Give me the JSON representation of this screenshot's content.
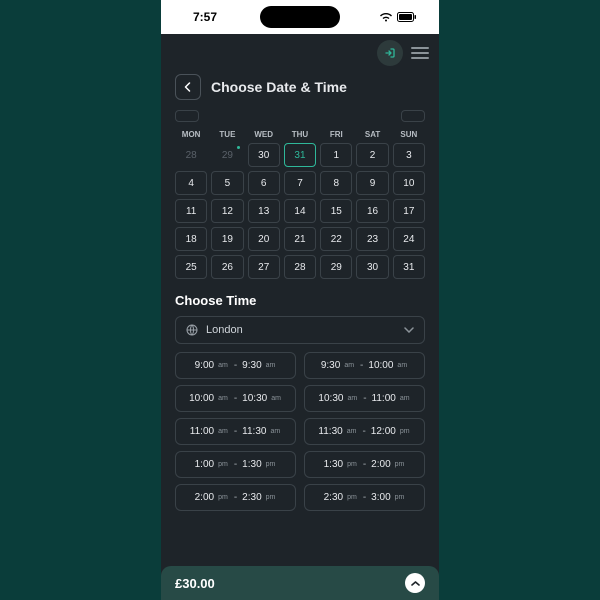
{
  "statusbar": {
    "time": "7:57"
  },
  "header": {
    "title": "Choose Date & Time"
  },
  "dow": [
    "MON",
    "TUE",
    "WED",
    "THU",
    "FRI",
    "SAT",
    "SUN"
  ],
  "calendar": {
    "rows": [
      [
        {
          "n": "28",
          "dim": true
        },
        {
          "n": "29",
          "dim": true,
          "dot": true
        },
        {
          "n": "30"
        },
        {
          "n": "31",
          "sel": true
        },
        {
          "n": "1"
        },
        {
          "n": "2"
        },
        {
          "n": "3"
        }
      ],
      [
        {
          "n": "4"
        },
        {
          "n": "5"
        },
        {
          "n": "6"
        },
        {
          "n": "7"
        },
        {
          "n": "8"
        },
        {
          "n": "9"
        },
        {
          "n": "10"
        }
      ],
      [
        {
          "n": "11"
        },
        {
          "n": "12"
        },
        {
          "n": "13"
        },
        {
          "n": "14"
        },
        {
          "n": "15"
        },
        {
          "n": "16"
        },
        {
          "n": "17"
        }
      ],
      [
        {
          "n": "18"
        },
        {
          "n": "19"
        },
        {
          "n": "20"
        },
        {
          "n": "21"
        },
        {
          "n": "22"
        },
        {
          "n": "23"
        },
        {
          "n": "24"
        }
      ],
      [
        {
          "n": "25"
        },
        {
          "n": "26"
        },
        {
          "n": "27"
        },
        {
          "n": "28"
        },
        {
          "n": "29"
        },
        {
          "n": "30"
        },
        {
          "n": "31"
        }
      ]
    ]
  },
  "time_section": {
    "title": "Choose Time",
    "timezone": "London"
  },
  "slots": [
    {
      "s": "9:00",
      "sp": "am",
      "e": "9:30",
      "ep": "am"
    },
    {
      "s": "9:30",
      "sp": "am",
      "e": "10:00",
      "ep": "am"
    },
    {
      "s": "10:00",
      "sp": "am",
      "e": "10:30",
      "ep": "am"
    },
    {
      "s": "10:30",
      "sp": "am",
      "e": "11:00",
      "ep": "am"
    },
    {
      "s": "11:00",
      "sp": "am",
      "e": "11:30",
      "ep": "am"
    },
    {
      "s": "11:30",
      "sp": "am",
      "e": "12:00",
      "ep": "pm"
    },
    {
      "s": "1:00",
      "sp": "pm",
      "e": "1:30",
      "ep": "pm"
    },
    {
      "s": "1:30",
      "sp": "pm",
      "e": "2:00",
      "ep": "pm"
    },
    {
      "s": "2:00",
      "sp": "pm",
      "e": "2:30",
      "ep": "pm"
    },
    {
      "s": "2:30",
      "sp": "pm",
      "e": "3:00",
      "ep": "pm"
    }
  ],
  "footer": {
    "price": "£30.00"
  }
}
